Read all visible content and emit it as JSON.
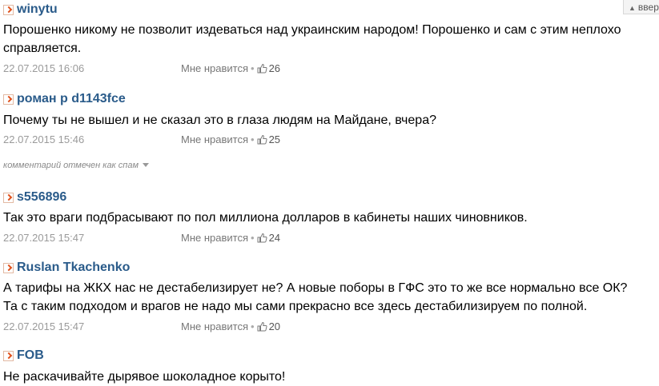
{
  "top_link": {
    "label": "вверх"
  },
  "spam_notice": "комментарий отмечен как спам",
  "comments": [
    {
      "author": "winytu",
      "lines": [
        "Порошенко никому не позволит издеваться над украинским народом! Порошенко и сам с этим неплохо",
        "справляется."
      ],
      "date": "22.07.2015 16:06",
      "like_label": "Мне нравится",
      "likes": "26"
    },
    {
      "author": "роман р d1143fce",
      "lines": [
        "Почему ты не вышел и не сказал это в глаза людям на Майдане, вчера?"
      ],
      "date": "22.07.2015 15:46",
      "like_label": "Мне нравится",
      "likes": "25"
    },
    {
      "author": "s556896",
      "lines": [
        "Так это враги подбрасывают по пол миллиона долларов в кабинеты наших чиновников."
      ],
      "date": "22.07.2015 15:47",
      "like_label": "Мне нравится",
      "likes": "24"
    },
    {
      "author": "Ruslan Tkachenko",
      "lines": [
        "А тарифы на ЖКХ нас не дестабелизирует не? А новые поборы в ГФС это то же все нормально все ОК?",
        "Та с таким подходом и врагов не надо мы сами прекрасно все здесь дестабилизируем по полной."
      ],
      "date": "22.07.2015 15:47",
      "like_label": "Мне нравится",
      "likes": "20"
    },
    {
      "author": "FOB",
      "lines": [
        "Не раскачивайте дырявое шоколадное корыто!"
      ],
      "date": "",
      "like_label": "",
      "likes": ""
    }
  ]
}
